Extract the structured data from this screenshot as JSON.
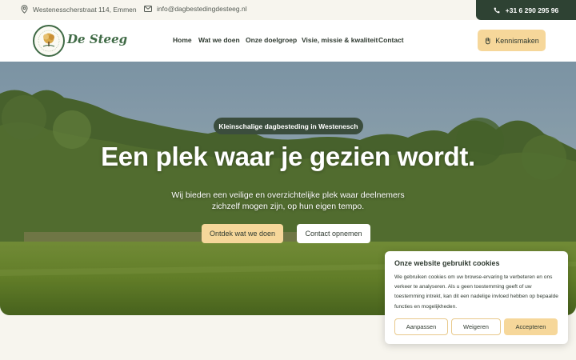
{
  "topbar": {
    "address": "Westenesscherstraat 114, Emmen",
    "email": "info@dagbestedingdesteeg.nl",
    "phone": "+31 6 290 295 96"
  },
  "brand": {
    "name": "De Steeg"
  },
  "nav": {
    "items": [
      "Home",
      "Wat we doen",
      "Onze doelgroep",
      "Visie, missie & kwaliteit",
      "Contact"
    ],
    "cta": "Kennismaken"
  },
  "hero": {
    "badge": "Kleinschalige dagbesteding in Westenesch",
    "title": "Een plek waar je gezien wordt.",
    "subtitle": "Wij bieden een veilige en overzichtelijke plek waar deelnemers zichzelf mogen zijn, op hun eigen tempo.",
    "primary_button": "Ontdek wat we doen",
    "secondary_button": "Contact opnemen"
  },
  "cookie": {
    "title": "Onze website gebruikt cookies",
    "text": "We gebruiken cookies om uw browse-ervaring te verbeteren en ons verkeer te analyseren. Als u geen toestemming geeft of uw toestemming intrekt, kan dit een nadelige invloed hebben op bepaalde functies en mogelijkheden.",
    "buttons": {
      "adjust": "Aanpassen",
      "deny": "Weigeren",
      "accept": "Accepteren"
    }
  },
  "colors": {
    "accent": "#f6d79a",
    "dark_green": "#2e4233",
    "brand_green": "#3f6a45"
  }
}
